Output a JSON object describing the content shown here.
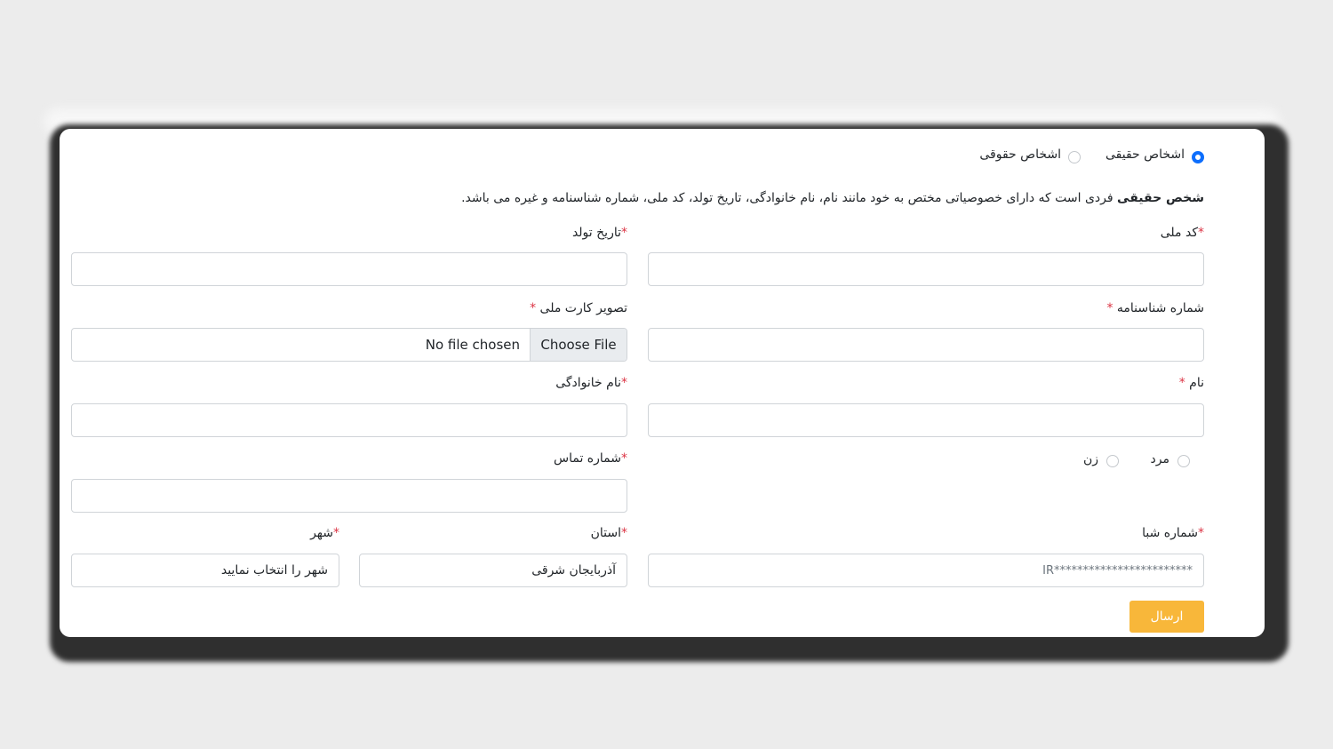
{
  "person_type": {
    "options": [
      {
        "label": "اشخاص حقیقی",
        "selected": true
      },
      {
        "label": "اشخاص حقوقی",
        "selected": false
      }
    ]
  },
  "description": {
    "bold": "شخص حقیقی",
    "text": " فردی است که دارای خصوصیاتی مختص به خود مانند نام، نام خانوادگی، تاریخ تولد، کد ملی، شماره شناسنامه و غیره می باشد."
  },
  "fields": {
    "national_code": {
      "label": "کد ملی",
      "required_mark": "*",
      "value": ""
    },
    "birth_date": {
      "label": "تاریخ تولد",
      "required_mark": "*",
      "value": ""
    },
    "id_number": {
      "label": "شماره شناسنامه",
      "required_mark": "*",
      "value": ""
    },
    "national_card_image": {
      "label": "تصویر کارت ملی",
      "required_mark": "*",
      "button": "Choose File",
      "status": "No file chosen"
    },
    "first_name": {
      "label": "نام",
      "required_mark": "*",
      "value": ""
    },
    "last_name": {
      "label": "نام خانوادگی",
      "required_mark": "*",
      "value": ""
    },
    "phone": {
      "label": "شماره تماس",
      "required_mark": "*",
      "value": ""
    },
    "sheba": {
      "label": "شماره شبا",
      "required_mark": "*",
      "placeholder": "IR************************"
    },
    "province": {
      "label": "استان",
      "required_mark": "*",
      "value": "آذربایجان شرقی"
    },
    "city": {
      "label": "شهر",
      "required_mark": "*",
      "value": "شهر را انتخاب نمایید"
    }
  },
  "gender": {
    "options": [
      {
        "label": "مرد",
        "selected": false
      },
      {
        "label": "زن",
        "selected": false
      }
    ]
  },
  "submit": {
    "label": "ارسال"
  },
  "colors": {
    "accent": "#0d6efd",
    "submit": "#f8b73a",
    "required": "#dc3545"
  }
}
